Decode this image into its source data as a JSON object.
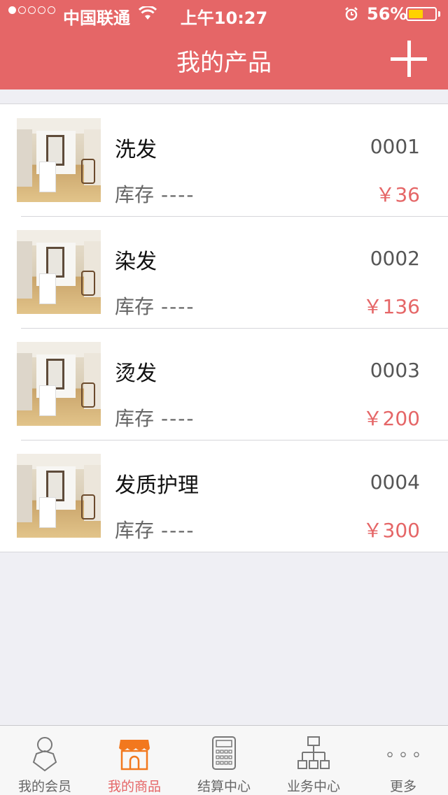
{
  "status_bar": {
    "carrier": "中国联通",
    "time": "上午10:27",
    "battery_percent": "56%",
    "battery_level": 0.56,
    "signal_bars": 1,
    "battery_color": "#ffd200"
  },
  "header": {
    "title": "我的产品",
    "add_icon": "plus-icon",
    "background": "#e56667"
  },
  "products": [
    {
      "name": "洗发",
      "code": "0001",
      "stock_label": "库存",
      "stock_value": "----",
      "price": "￥36"
    },
    {
      "name": "染发",
      "code": "0002",
      "stock_label": "库存",
      "stock_value": "----",
      "price": "￥136"
    },
    {
      "name": "烫发",
      "code": "0003",
      "stock_label": "库存",
      "stock_value": "----",
      "price": "￥200"
    },
    {
      "name": "发质护理",
      "code": "0004",
      "stock_label": "库存",
      "stock_value": "----",
      "price": "￥300"
    }
  ],
  "tabbar": {
    "active_index": 1,
    "accent": "#e56667",
    "tabs": [
      {
        "label": "我的会员",
        "icon": "member-icon"
      },
      {
        "label": "我的商品",
        "icon": "shop-icon"
      },
      {
        "label": "结算中心",
        "icon": "calculator-icon"
      },
      {
        "label": "业务中心",
        "icon": "org-chart-icon"
      },
      {
        "label": "更多",
        "icon": "more-icon"
      }
    ]
  }
}
